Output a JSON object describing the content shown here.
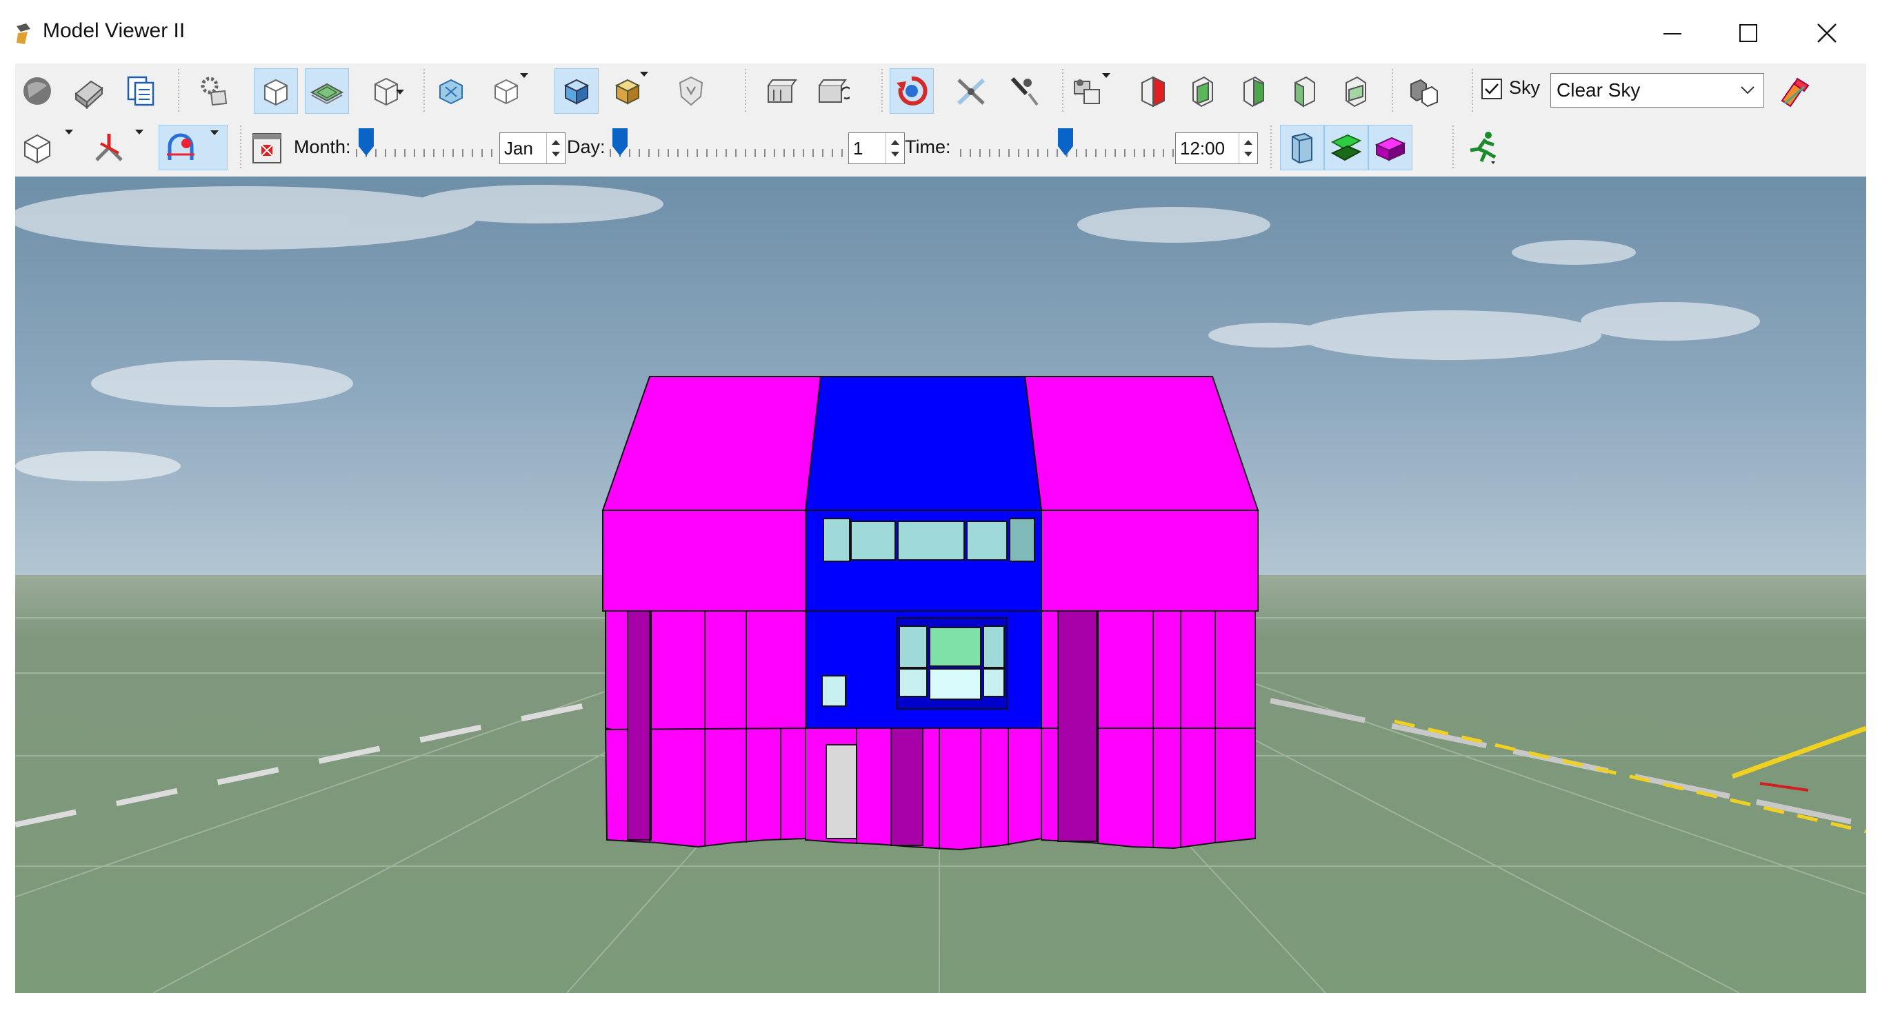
{
  "window": {
    "title": "Model Viewer II"
  },
  "toolbar2": {
    "month_label": "Month:",
    "month_value": "Jan",
    "day_label": "Day:",
    "day_value": "1",
    "time_label": "Time:",
    "time_value": "12:00"
  },
  "sky": {
    "label": "Sky",
    "checked": true,
    "selected": "Clear Sky"
  },
  "colors": {
    "toolbar_bg": "#f0f0f0",
    "active_button": "#cce4f7",
    "wall_magenta": "#ff00ff",
    "wall_blue": "#0000ff",
    "window_glass": "#9fd9d9",
    "ground": "#7a9a78",
    "slider_thumb": "#0a64c8"
  },
  "icons": [
    "globe-icon",
    "open-model-icon",
    "copy-icon",
    "settings-icon",
    "wireframe-view-icon",
    "layers-view-icon",
    "box-view-icon",
    "zoom-extents-icon",
    "cube-select-icon",
    "solid-shaded-icon",
    "textured-box-icon",
    "shield-icon",
    "camera-icon",
    "camera-rotate-icon",
    "orbit-icon",
    "pan-icon",
    "walk-icon",
    "render-settings-icon",
    "red-surface-icon",
    "green-surface-icon",
    "surface-icon",
    "surface-2-icon",
    "surface-3-icon",
    "properties-icon",
    "paint-icon",
    "view-cube-icon",
    "axis-icon",
    "sun-path-icon",
    "calendar-icon",
    "building-blue-icon",
    "green-plane-icon",
    "magenta-box-icon",
    "runner-icon"
  ]
}
